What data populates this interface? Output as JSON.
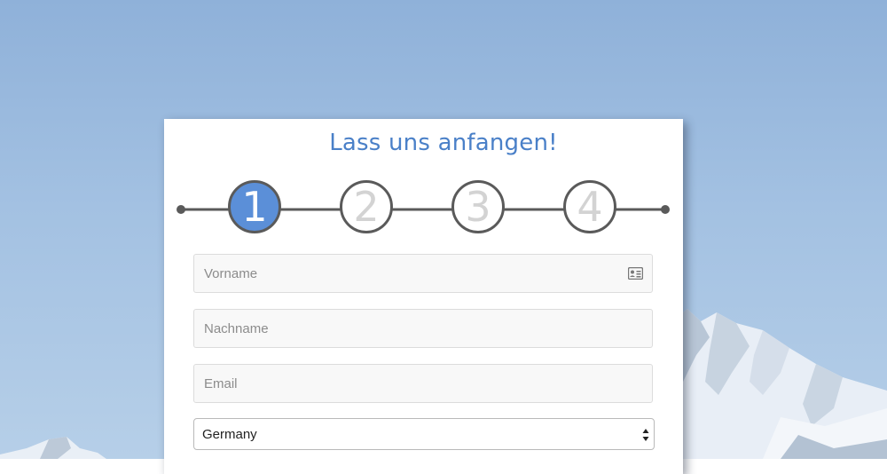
{
  "form": {
    "title": "Lass uns anfangen!",
    "steps": [
      {
        "number": "1",
        "active": true
      },
      {
        "number": "2",
        "active": false
      },
      {
        "number": "3",
        "active": false
      },
      {
        "number": "4",
        "active": false
      }
    ],
    "fields": {
      "first_name": {
        "placeholder": "Vorname",
        "value": "",
        "icon": "id-card-icon"
      },
      "last_name": {
        "placeholder": "Nachname",
        "value": ""
      },
      "email": {
        "placeholder": "Email",
        "value": ""
      }
    },
    "country": {
      "selected": "Germany",
      "icon": "select-arrows-icon"
    }
  },
  "colors": {
    "accent": "#4a80c8",
    "active_step": "#5b8fd8",
    "step_border": "#5a5a5a",
    "inactive_step_text": "#d3d3d3",
    "field_bg": "#f8f8f8"
  }
}
